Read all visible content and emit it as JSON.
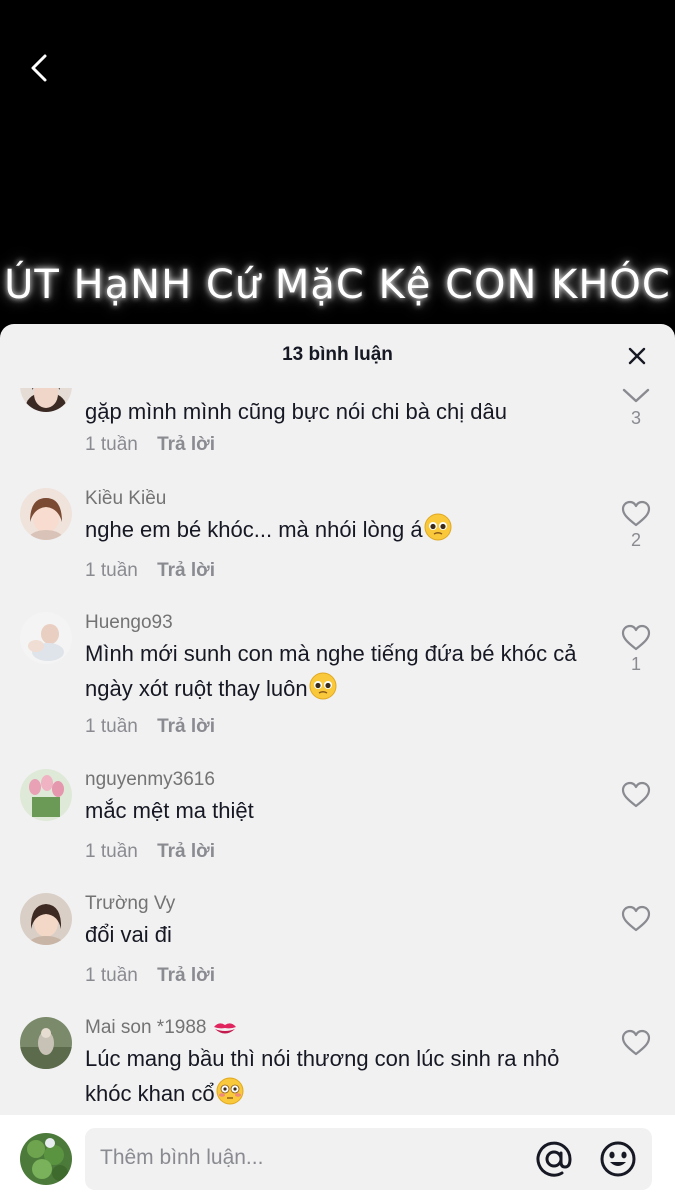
{
  "video": {
    "caption": "ÚT HạNH Cứ MặC Kệ CON KHÓC"
  },
  "sheet": {
    "title": "13 bình luận"
  },
  "comments": [
    {
      "username": "",
      "text": "gặp mình mình cũng bực nói chi bà chị dâu",
      "time": "1 tuần",
      "reply": "Trả lời",
      "likes": "3",
      "like_icon": "chevron-down-icon"
    },
    {
      "username": "Kiều Kiều",
      "text": "nghe em bé khóc... mà nhói lòng á",
      "emoji": "pleading-face",
      "time": "1 tuần",
      "reply": "Trả lời",
      "likes": "2"
    },
    {
      "username": "Huengo93",
      "text": "Mình mới sunh con mà nghe tiếng đứa bé khóc cả ngày xót ruột thay luôn",
      "emoji": "pleading-face",
      "time": "1 tuần",
      "reply": "Trả lời",
      "likes": "1"
    },
    {
      "username": "nguyenmy3616",
      "text": "mắc mệt ma thiệt",
      "time": "1 tuần",
      "reply": "Trả lời",
      "likes": ""
    },
    {
      "username": "Trường Vy",
      "text": "đổi vai đi",
      "time": "1 tuần",
      "reply": "Trả lời",
      "likes": ""
    },
    {
      "username": "Mai son *1988",
      "username_emoji": "kiss-mark",
      "text": "Lúc mang bầu thì nói thương con lúc sinh ra nhỏ khóc khan cổ",
      "emoji": "flushed-face",
      "time": "",
      "reply": "",
      "likes": ""
    }
  ],
  "input": {
    "placeholder": "Thêm bình luận..."
  },
  "colors": {
    "sheet_bg": "#f1f1f2",
    "text": "#161823",
    "muted": "#8a8b91"
  }
}
